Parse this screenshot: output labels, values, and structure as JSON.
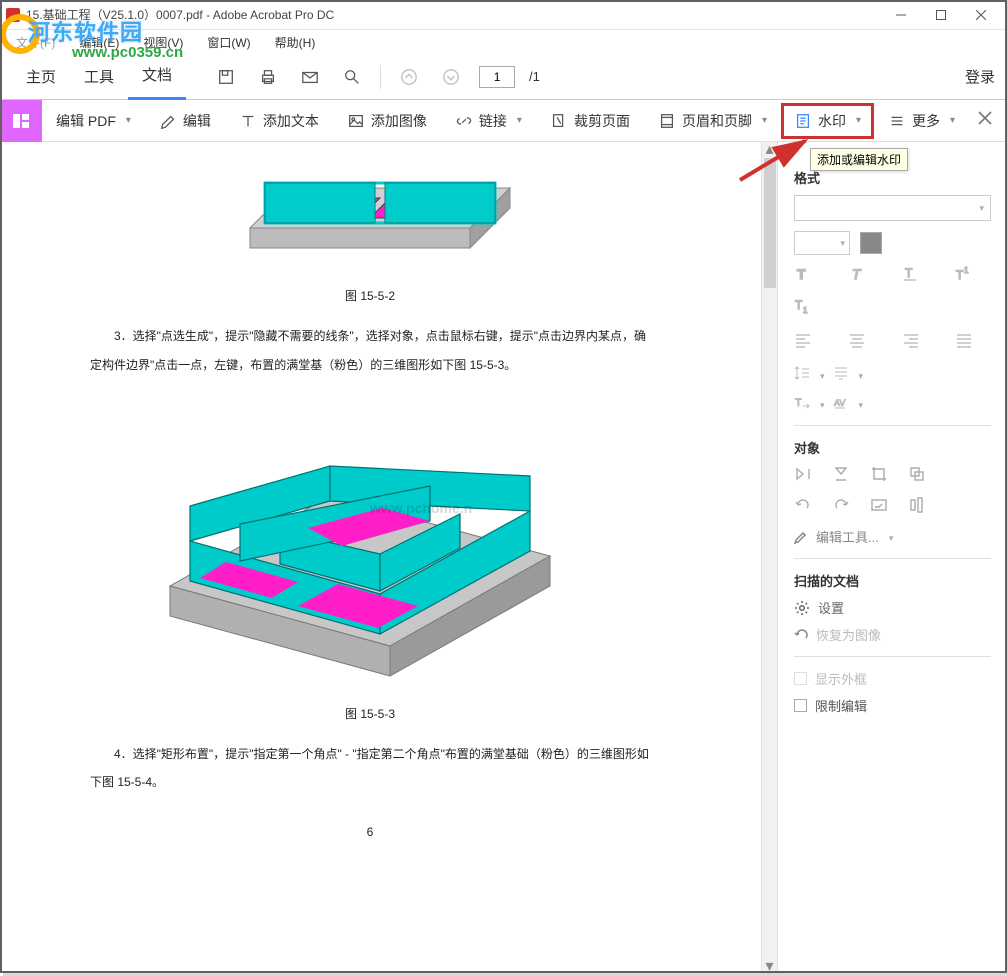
{
  "watermark": {
    "text": "河东软件园",
    "url": "www.pc0359.cn"
  },
  "titlebar": {
    "title": "15.基础工程（V25.1.0）0007.pdf - Adobe Acrobat Pro DC"
  },
  "menubar": {
    "items": [
      {
        "label": "文件(F)",
        "disabled": true
      },
      {
        "label": "编辑(E)"
      },
      {
        "label": "视图(V)"
      },
      {
        "label": "窗口(W)"
      },
      {
        "label": "帮助(H)"
      }
    ]
  },
  "tabs": {
    "items": [
      "主页",
      "工具",
      "文档"
    ],
    "selected_index": 2
  },
  "toolbar": {
    "page_current": "1",
    "page_total": "/1",
    "login": "登录"
  },
  "edit_toolbar": {
    "main": "编辑 PDF",
    "items": [
      {
        "icon": "edit-icon",
        "label": "编辑"
      },
      {
        "icon": "text-icon",
        "label": "添加文本"
      },
      {
        "icon": "image-icon",
        "label": "添加图像"
      },
      {
        "icon": "link-icon",
        "label": "链接",
        "dropdown": true
      },
      {
        "icon": "crop-icon",
        "label": "裁剪页面"
      },
      {
        "icon": "header-footer-icon",
        "label": "页眉和页脚",
        "dropdown": true
      },
      {
        "icon": "watermark-icon",
        "label": "水印",
        "dropdown": true,
        "highlight": true
      },
      {
        "icon": "more-icon",
        "label": "更多",
        "dropdown": true
      }
    ]
  },
  "tooltip": "添加或编辑水印",
  "document": {
    "caption1": "图 15-5-2",
    "para3": "3．选择\"点选生成\"，提示\"隐藏不需要的线条\"，选择对象，点击鼠标右键，提示\"点击边界内某点，确定构件边界\"点击一点，左键，布置的满堂基（粉色）的三维图形如下图 15-5-3。",
    "caption2": "图 15-5-3",
    "para4": "4．选择\"矩形布置\"，提示\"指定第一个角点\" - \"指定第二个角点\"布置的满堂基础（粉色）的三维图形如下图 15-5-4。",
    "pagenum": "6",
    "overlay": "www.pchome.n"
  },
  "rpanel": {
    "format_title": "格式",
    "object_title": "对象",
    "edit_tools": "编辑工具...",
    "scan_title": "扫描的文档",
    "settings": "设置",
    "restore": "恢复为图像",
    "show_outline": "显示外框",
    "limit_edit": "限制编辑"
  }
}
